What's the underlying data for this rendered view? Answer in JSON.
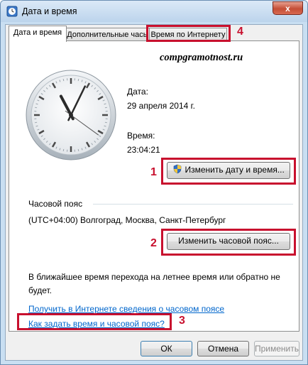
{
  "window": {
    "title": "Дата и время",
    "close_glyph": "x"
  },
  "tabs": [
    {
      "label": "Дата и время",
      "active": true
    },
    {
      "label": "Дополнительные часы",
      "active": false
    },
    {
      "label": "Время по Интернету",
      "active": false
    }
  ],
  "watermark": "compgramotnost.ru",
  "clock": {
    "hours": 23,
    "minutes": 4,
    "seconds": 21
  },
  "date": {
    "label": "Дата:",
    "value": "29 апреля 2014 г."
  },
  "time": {
    "label": "Время:",
    "value": "23:04:21"
  },
  "buttons": {
    "change_datetime": "Изменить дату и время...",
    "change_timezone": "Изменить часовой пояс...",
    "ok": "ОК",
    "cancel": "Отмена",
    "apply": "Применить"
  },
  "timezone": {
    "section_label": "Часовой пояс",
    "value": "(UTC+04:00) Волгоград, Москва, Санкт-Петербург"
  },
  "dst_note": "В ближайшее время перехода на летнее время или обратно не будет.",
  "links": {
    "online_info": "Получить в Интернете сведения о часовом поясе",
    "how_to": "Как задать время и часовой пояс?"
  },
  "annotations": {
    "n1": "1",
    "n2": "2",
    "n3": "3",
    "n4": "4"
  },
  "colors": {
    "highlight": "#c8102e",
    "link": "#0066cc",
    "window_border": "#6b8fb3"
  }
}
